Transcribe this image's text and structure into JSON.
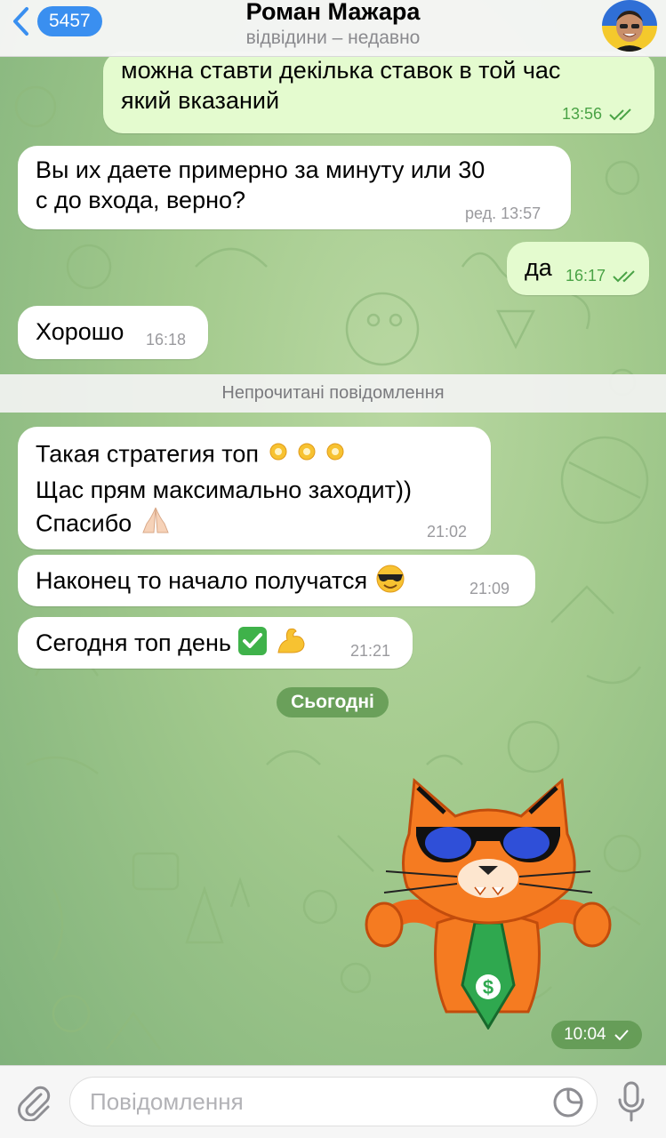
{
  "header": {
    "back_count": "5457",
    "title": "Роман Мажара",
    "subtitle": "відвідини – недавно"
  },
  "messages": [
    {
      "direction": "out",
      "text_line1": "можна ставти декілька ставок в той час",
      "text_line2": "який вказаний",
      "time": "13:56",
      "read": true
    },
    {
      "direction": "in",
      "text_line1": "Вы их даете примерно за минуту или 30",
      "text_line2": "с до входа, верно?",
      "time": "ред. 13:57"
    },
    {
      "direction": "out",
      "text": "да",
      "time": "16:17",
      "read": true
    },
    {
      "direction": "in",
      "text": "Хорошо",
      "time": "16:18"
    },
    {
      "direction": "in",
      "text_line1": "Такая стратегия топ",
      "text_line2": "Щас прям максимально заходит))",
      "text_line3": "Спасибо",
      "time": "21:02"
    },
    {
      "direction": "in",
      "text": "Наконец то начало получатся",
      "time": "21:09"
    },
    {
      "direction": "in",
      "text": "Сегодня топ день",
      "time": "21:21"
    }
  ],
  "unread_separator": "Непрочитані повідомлення",
  "date_separator": "Сьогодні",
  "sticker": {
    "time": "10:04",
    "description_icon": "orange-cat-sunglasses-dollar-tie-sticker"
  },
  "input": {
    "placeholder": "Повідомлення"
  },
  "colors": {
    "accent": "#3a8ff0",
    "outgoing_bubble": "#e4fbcf",
    "incoming_bubble": "#ffffff",
    "outgoing_time": "#4aa346"
  }
}
